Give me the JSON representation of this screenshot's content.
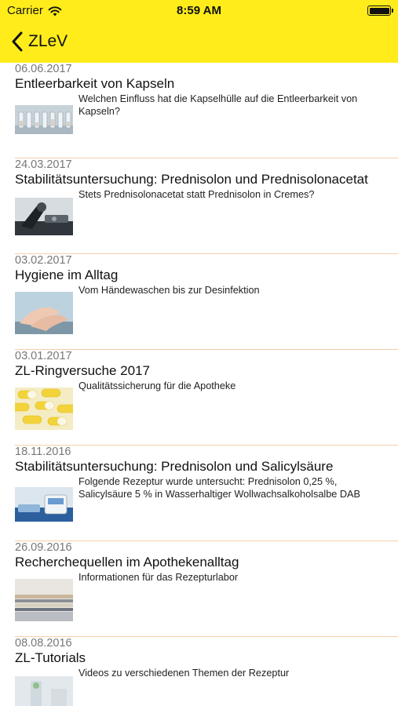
{
  "status_bar": {
    "carrier": "Carrier",
    "time": "8:59 AM"
  },
  "nav": {
    "back_label": "ZLeV"
  },
  "articles": [
    {
      "date": "06.06.2017",
      "title": "Entleerbarkeit von Kapseln",
      "description": "Welchen Einfluss hat die Kapselhülle auf die Entleerbarkeit von Kapseln?",
      "thumbnail": "capsules-in-vials"
    },
    {
      "date": "24.03.2017",
      "title": "Stabilitätsuntersuchung: Prednisolon und Prednisolonacetat",
      "description": "Stets Prednisolonacetat statt Prednisolon in Cremes?",
      "thumbnail": "microscope"
    },
    {
      "date": "03.02.2017",
      "title": "Hygiene im Alltag",
      "description": "Vom Händewaschen bis zur Desinfektion",
      "thumbnail": "hands"
    },
    {
      "date": "03.01.2017",
      "title": "ZL-Ringversuche 2017",
      "description": "Qualitätssicherung für die Apotheke",
      "thumbnail": "yellow-capsules"
    },
    {
      "date": "18.11.2016",
      "title": "Stabilitätsuntersuchung: Prednisolon und Salicylsäure",
      "description": "Folgende Rezeptur wurde untersucht: Prednisolon 0,25 %, Salicylsäure 5 % in Wasserhaltiger Wollwachsalkoholsalbe DAB",
      "thumbnail": "ointment-jar"
    },
    {
      "date": "26.09.2016",
      "title": "Recherchequellen im Apothekenalltag",
      "description": "Informationen für das Rezepturlabor",
      "thumbnail": "books"
    },
    {
      "date": "08.08.2016",
      "title": "ZL-Tutorials",
      "description": "Videos zu verschiedenen Themen der Rezeptur",
      "thumbnail": "lab-bench"
    }
  ],
  "colors": {
    "nav_background": "#ffec1a",
    "separator": "#f5cfa8",
    "date_text": "#777777"
  }
}
